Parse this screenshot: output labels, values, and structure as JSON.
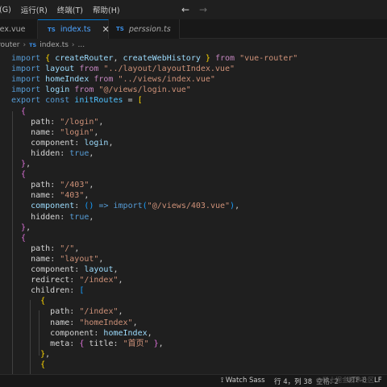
{
  "menu": {
    "items": [
      "(G)",
      "运行(R)",
      "终端(T)",
      "帮助(H)"
    ]
  },
  "tabs": [
    {
      "label": "lex.vue",
      "type": "",
      "active": false
    },
    {
      "label": "index.ts",
      "type": "TS",
      "active": true
    },
    {
      "label": "perssion.ts",
      "type": "TS",
      "active": false
    }
  ],
  "breadcrumb": {
    "folder": "router",
    "file_type": "TS",
    "file": "index.ts",
    "tail": "..."
  },
  "code": [
    "import { createRouter, createWebHistory } from \"vue-router\"",
    "import layout from \"../layout/layoutIndex.vue\"",
    "import homeIndex from \"../views/index.vue\"",
    "import login from \"@/views/login.vue\"",
    "export const initRoutes = [",
    "  {",
    "    path: \"/login\",",
    "    name: \"login\",",
    "    component: login,",
    "    hidden: true,",
    "  },",
    "  {",
    "    path: \"/403\",",
    "    name: \"403\",",
    "    component: () => import(\"@/views/403.vue\"),",
    "    hidden: true,",
    "  },",
    "  {",
    "    path: \"/\",",
    "    name: \"layout\",",
    "    component: layout,",
    "    redirect: \"/index\",",
    "    children: [",
    "      {",
    "        path: \"/index\",",
    "        name: \"homeIndex\",",
    "        component: homeIndex,",
    "        meta: { title: \"首页\" },",
    "      },",
    "      {"
  ],
  "status": {
    "watch_sass": "Watch Sass",
    "position": "行 4，列 38",
    "spaces": "空格: 2",
    "encoding": "UTF-8",
    "eol": "LF"
  },
  "watermark": "@稀土掘金技术社区"
}
